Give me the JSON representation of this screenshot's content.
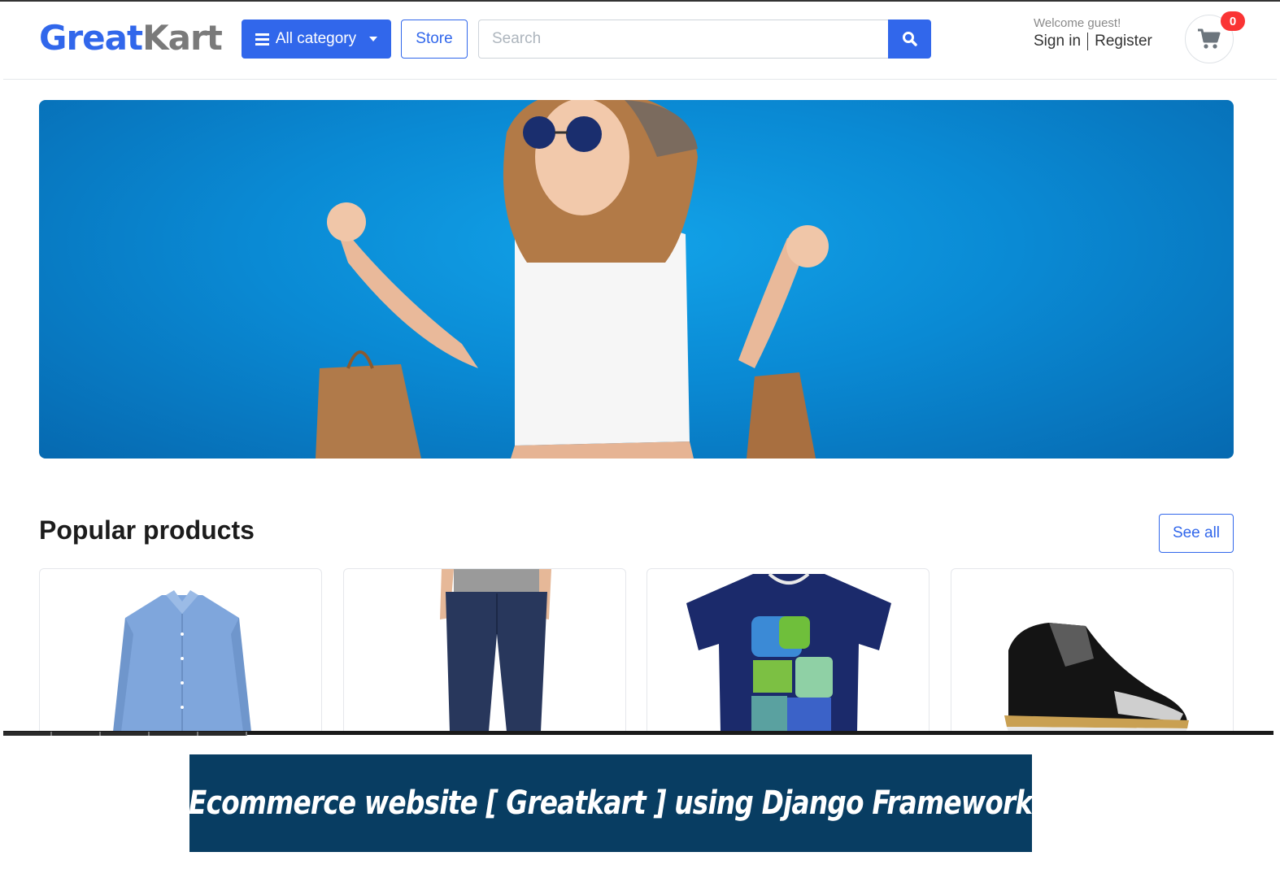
{
  "header": {
    "logo_part1": "Great",
    "logo_part2": "Kart",
    "category_button": "All category",
    "store_button": "Store",
    "search_placeholder": "Search",
    "welcome_text": "Welcome guest!",
    "sign_in": "Sign in",
    "register": "Register",
    "cart_count": "0"
  },
  "colors": {
    "brand_blue": "#3167eb",
    "logo_gray": "#7a7a7a",
    "badge_red": "#fa3434",
    "hero_blue": "#0a8ad4",
    "banner_navy": "#083d62"
  },
  "hero": {
    "description_icon": "hero-banner-image"
  },
  "popular": {
    "title": "Popular products",
    "see_all": "See all",
    "products": [
      {
        "image": "blue-shirt-image"
      },
      {
        "image": "jeans-image"
      },
      {
        "image": "graphic-tshirt-image"
      },
      {
        "image": "sneaker-image"
      }
    ]
  },
  "banner": {
    "text": "Ecommerce website [ Greatkart ]  using Django Framework"
  }
}
